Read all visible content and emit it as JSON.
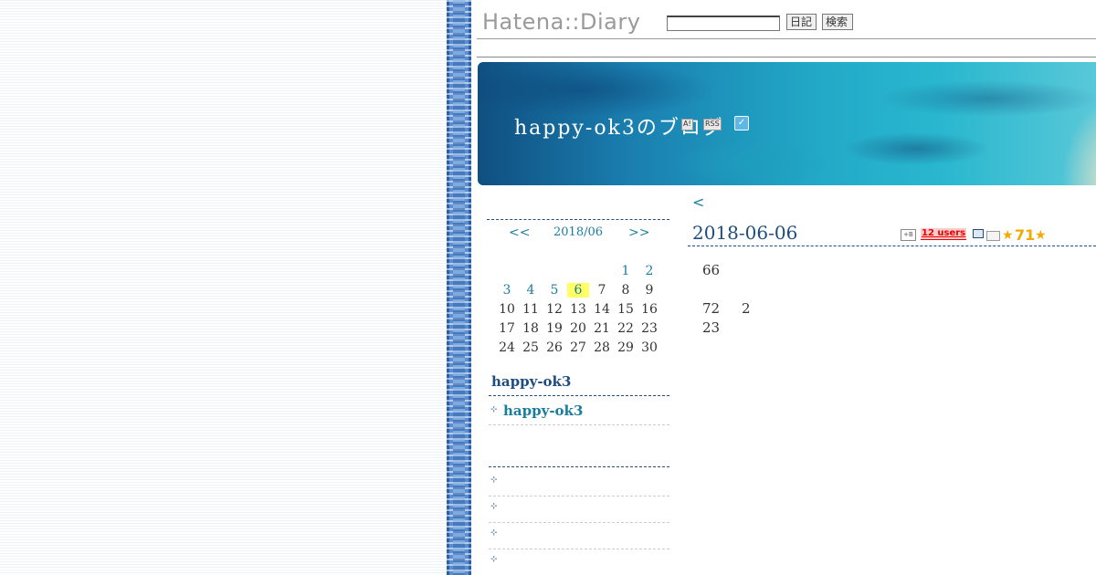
{
  "header": {
    "logo": "Hatena::Diary",
    "search_value": "",
    "diary_button": "日記",
    "search_button": "検索"
  },
  "banner": {
    "title": "happy-ok3のブログ",
    "hatena_icon": "A!",
    "rss_icon": "RSS",
    "twitter_icon": "twitter-bird"
  },
  "nav": {
    "back": "<"
  },
  "calendar": {
    "prev": "<<",
    "month": "2018/06",
    "next": ">>",
    "days": [
      {
        "d": "1",
        "link": true
      },
      {
        "d": "2",
        "link": true
      },
      {
        "d": "3",
        "link": true
      },
      {
        "d": "4",
        "link": true
      },
      {
        "d": "5",
        "link": true
      },
      {
        "d": "6",
        "link": true,
        "today": true
      },
      {
        "d": "7"
      },
      {
        "d": "8"
      },
      {
        "d": "9"
      },
      {
        "d": "10"
      },
      {
        "d": "11"
      },
      {
        "d": "12"
      },
      {
        "d": "13"
      },
      {
        "d": "14"
      },
      {
        "d": "15"
      },
      {
        "d": "16"
      },
      {
        "d": "17"
      },
      {
        "d": "18"
      },
      {
        "d": "19"
      },
      {
        "d": "20"
      },
      {
        "d": "21"
      },
      {
        "d": "22"
      },
      {
        "d": "23"
      },
      {
        "d": "24"
      },
      {
        "d": "25"
      },
      {
        "d": "26"
      },
      {
        "d": "27"
      },
      {
        "d": "28"
      },
      {
        "d": "29"
      },
      {
        "d": "30"
      }
    ]
  },
  "sidebar": {
    "section_title": "happy-ok3",
    "profile_link": "happy-ok3"
  },
  "entry": {
    "date": "2018-06-06",
    "hatebu_icon": "+B",
    "users_badge": "12 users",
    "star_count": "71",
    "lines": [
      {
        "a": "66"
      },
      {
        "a": "72",
        "b": "2"
      },
      {
        "a": "23"
      }
    ]
  },
  "colors": {
    "link": "#1a7d9e",
    "heading": "#1e4d7e",
    "today_highlight": "#ffff66",
    "star": "#f2a900"
  }
}
